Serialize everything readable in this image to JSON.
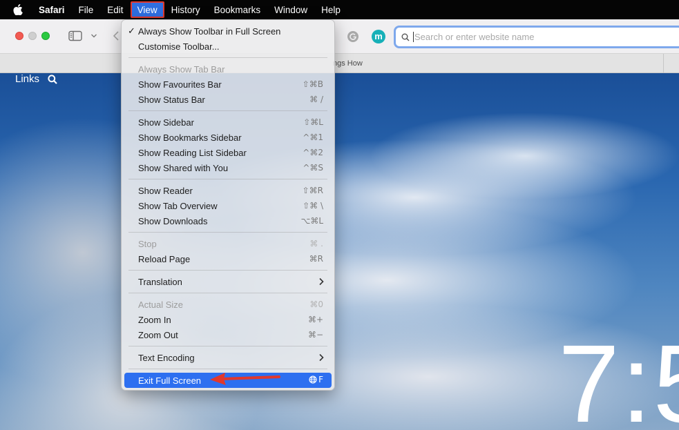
{
  "menubar": {
    "items": [
      {
        "label": "Safari"
      },
      {
        "label": "File"
      },
      {
        "label": "Edit"
      },
      {
        "label": "View"
      },
      {
        "label": "History"
      },
      {
        "label": "Bookmarks"
      },
      {
        "label": "Window"
      },
      {
        "label": "Help"
      }
    ]
  },
  "toolbar": {
    "avatar_letter": "m",
    "address_placeholder": "Search or enter website name"
  },
  "tabbar": {
    "tab_title": "ngs How"
  },
  "content": {
    "links_label": "Links",
    "clock_text": "7:5"
  },
  "view_menu": {
    "items": [
      {
        "label": "Always Show Toolbar in Full Screen",
        "checked": "✓",
        "shortcut": ""
      },
      {
        "label": "Customise Toolbar...",
        "shortcut": ""
      },
      {
        "label": "Always Show Tab Bar",
        "shortcut": ""
      },
      {
        "label": "Show Favourites Bar",
        "shortcut": "⇧⌘B"
      },
      {
        "label": "Show Status Bar",
        "shortcut": "⌘ /"
      },
      {
        "label": "Show Sidebar",
        "shortcut": "⇧⌘L"
      },
      {
        "label": "Show Bookmarks Sidebar",
        "shortcut": "^⌘1"
      },
      {
        "label": "Show Reading List Sidebar",
        "shortcut": "^⌘2"
      },
      {
        "label": "Show Shared with You",
        "shortcut": "^⌘S"
      },
      {
        "label": "Show Reader",
        "shortcut": "⇧⌘R"
      },
      {
        "label": "Show Tab Overview",
        "shortcut": "⇧⌘ \\"
      },
      {
        "label": "Show Downloads",
        "shortcut": "⌥⌘L"
      },
      {
        "label": "Stop",
        "shortcut": "⌘ ."
      },
      {
        "label": "Reload Page",
        "shortcut": "⌘R"
      },
      {
        "label": "Translation",
        "shortcut": ""
      },
      {
        "label": "Actual Size",
        "shortcut": "⌘0"
      },
      {
        "label": "Zoom In",
        "shortcut": "⌘+"
      },
      {
        "label": "Zoom Out",
        "shortcut": "⌘−"
      },
      {
        "label": "Text Encoding",
        "shortcut": ""
      },
      {
        "label": "Exit Full Screen",
        "shortcut": "F"
      }
    ]
  },
  "colors": {
    "menu_highlight": "#2d6ff0",
    "annotation_red": "#e1382c"
  }
}
